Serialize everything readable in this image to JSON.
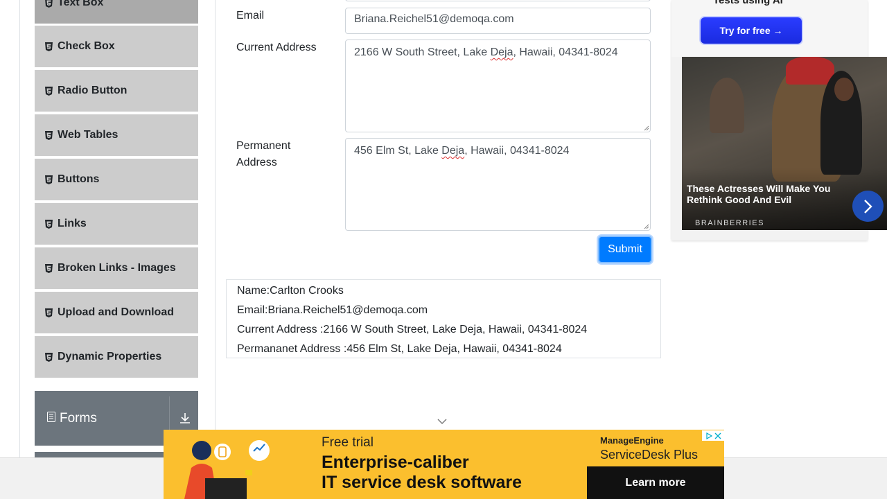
{
  "sidebar": {
    "items": [
      {
        "label": "Text Box"
      },
      {
        "label": "Check Box"
      },
      {
        "label": "Radio Button"
      },
      {
        "label": "Web Tables"
      },
      {
        "label": "Buttons"
      },
      {
        "label": "Links"
      },
      {
        "label": "Broken Links - Images"
      },
      {
        "label": "Upload and Download"
      },
      {
        "label": "Dynamic Properties"
      }
    ],
    "group": {
      "label": "Forms"
    }
  },
  "form": {
    "email": {
      "label": "Email",
      "value": "Briana.Reichel51@demoqa.com"
    },
    "current_address": {
      "label": "Current Address",
      "prefix": "2166 W South Street, Lake ",
      "flagged": "Deja",
      "suffix": ", Hawaii, 04341-8024"
    },
    "permanent_address": {
      "label_line1": "Permanent",
      "label_line2": "Address",
      "prefix": "456 Elm St, Lake ",
      "flagged": "Deja",
      "suffix": ", Hawaii, 04341-8024"
    },
    "submit_label": "Submit"
  },
  "output": {
    "name": "Name:Carlton Crooks",
    "email": "Email:Briana.Reichel51@demoqa.com",
    "current_address": "Current Address :2166 W South Street, Lake Deja, Hawaii, 04341-8024",
    "permanent_address": "Permananet Address :456 Elm St, Lake Deja, Hawaii, 04341-8024"
  },
  "ad_right": {
    "top_text": "Tests using AI",
    "cta": "Try for free →",
    "headline": "These Actresses Will Make You Rethink Good And Evil",
    "brand": "BRAINBERRIES"
  },
  "ad_bottom": {
    "line1": "Free trial",
    "line2": "Enterprise-caliber",
    "line3": "IT service desk software",
    "brand_line1": "ManageEngine",
    "brand_line2": "ServiceDesk Plus",
    "cta": "Learn more"
  },
  "colors": {
    "accent": "#007bff",
    "sidebar": "#cccccc",
    "group_header": "#6c757d",
    "banner": "#fbbf2e"
  }
}
